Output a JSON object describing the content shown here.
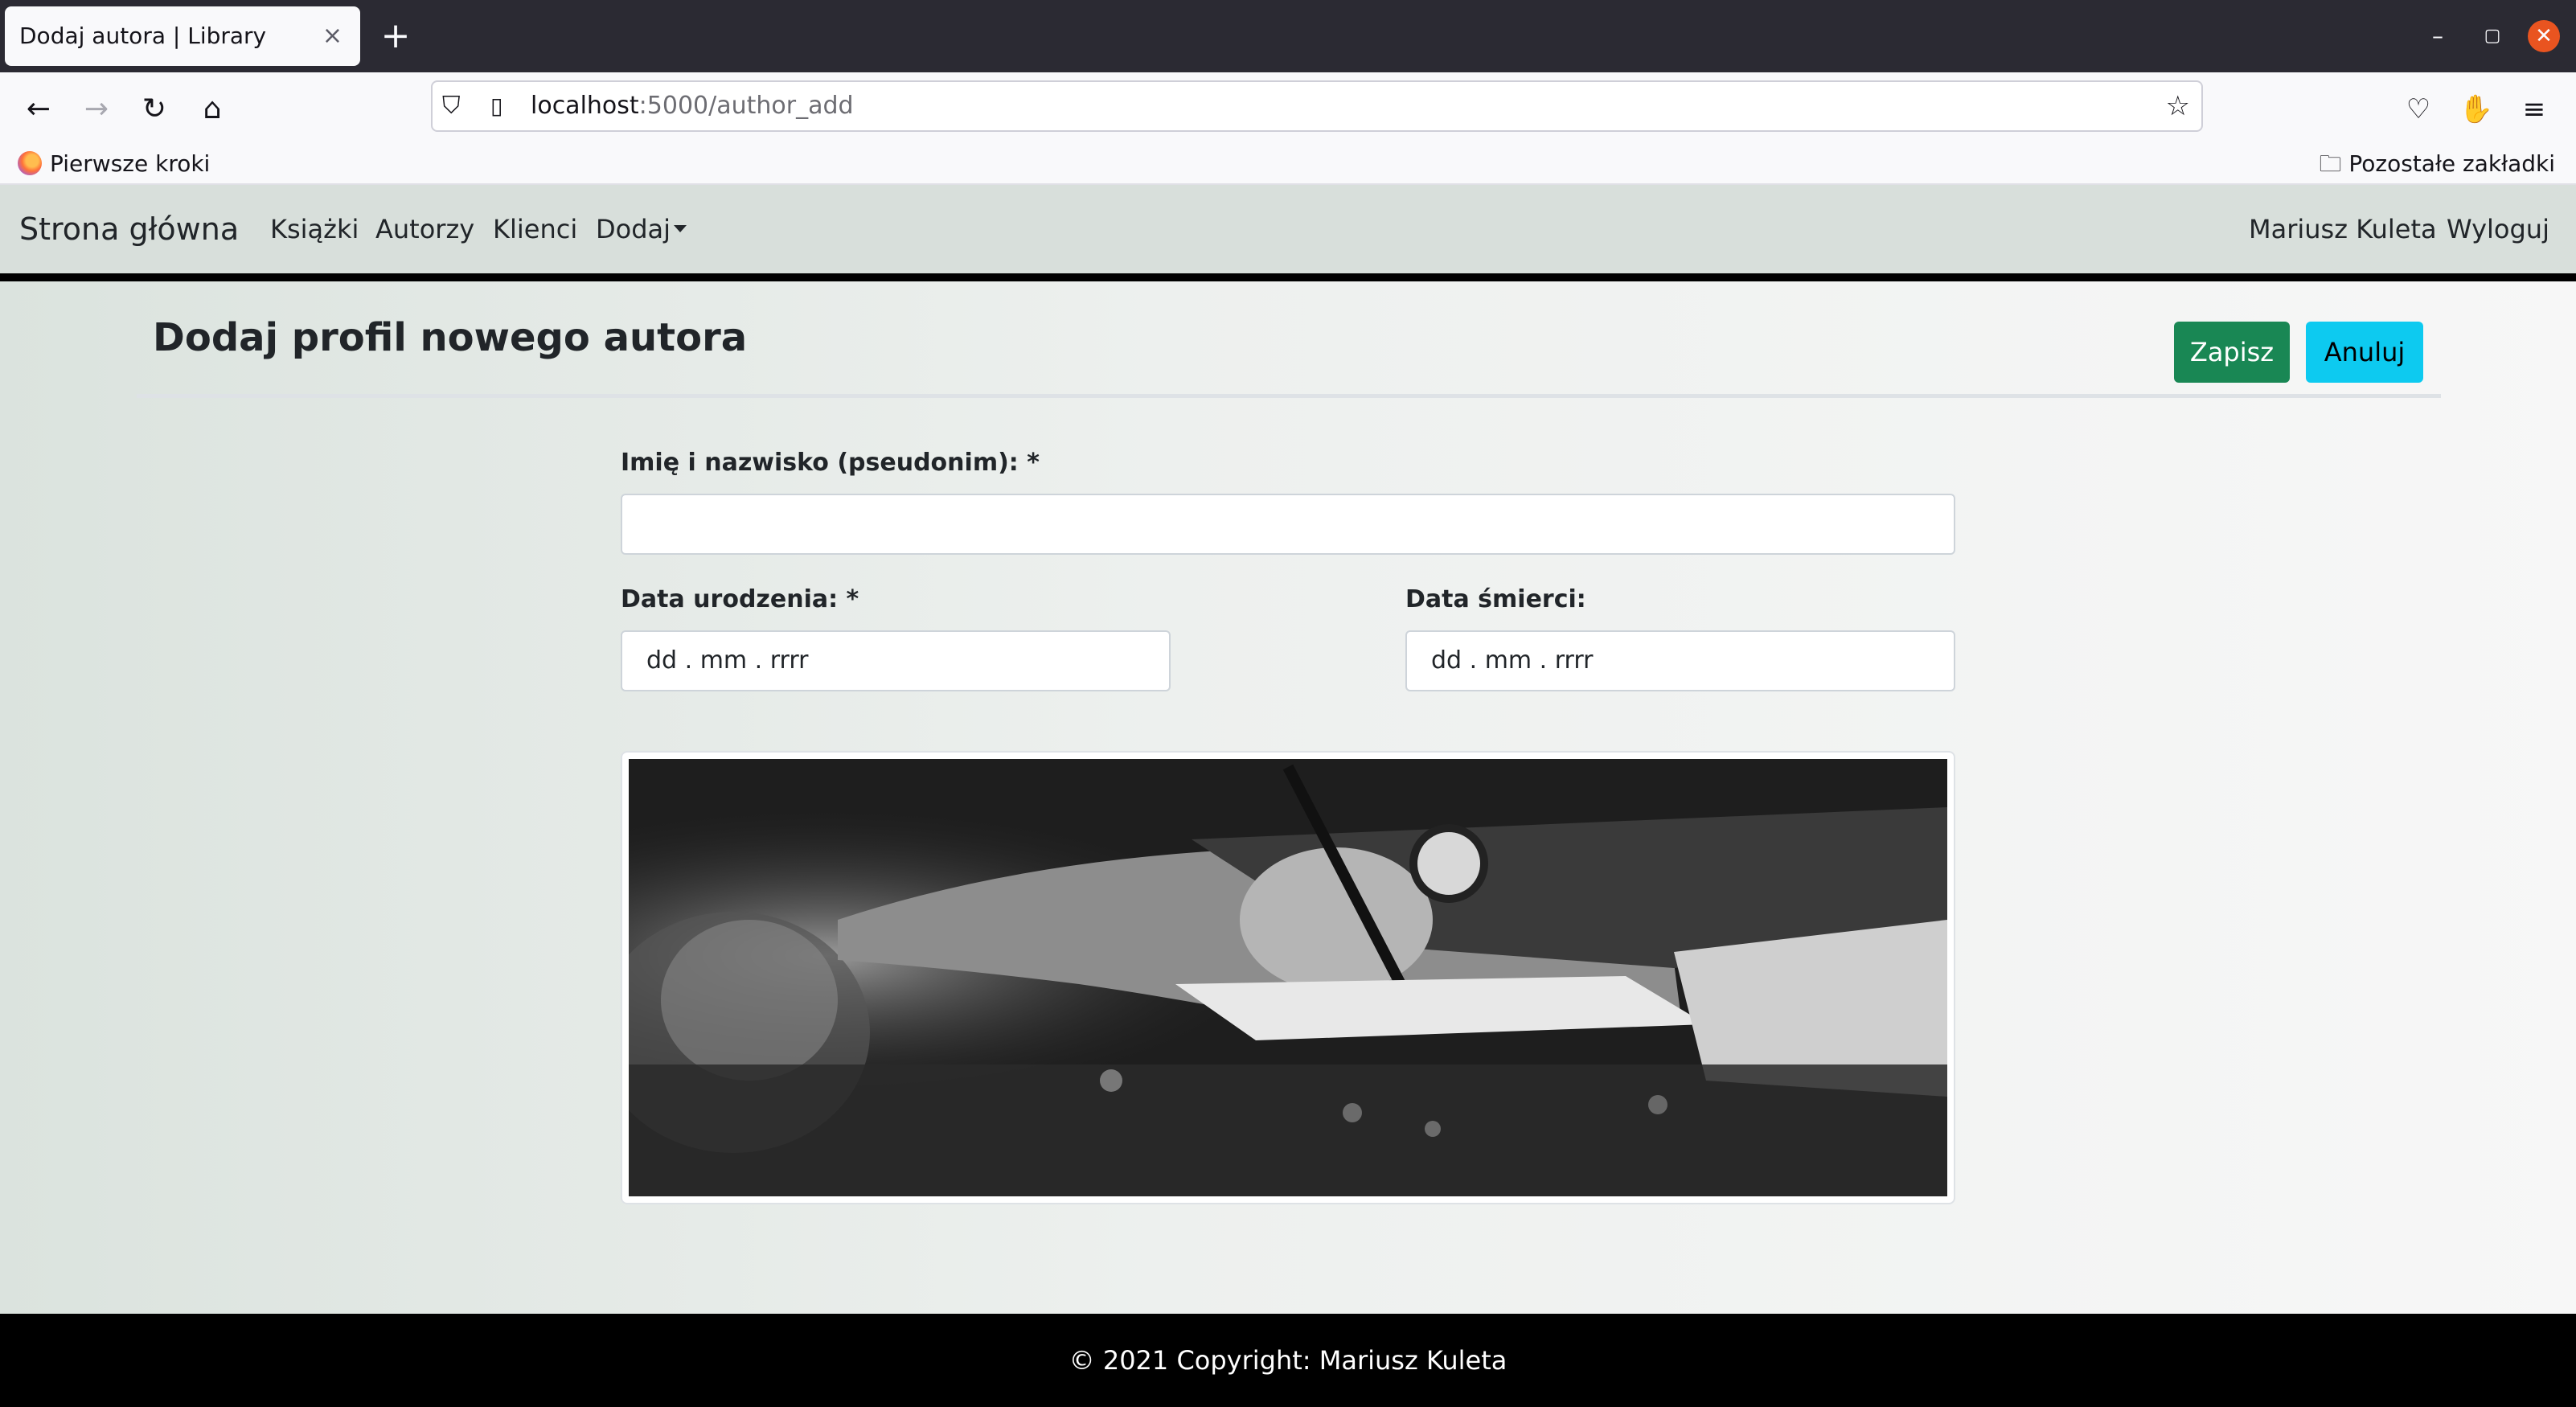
{
  "browser": {
    "tab_title": "Dodaj autora | Library",
    "tab_close": "×",
    "new_tab": "+",
    "url_host": "localhost",
    "url_path": ":5000/author_add",
    "bookmark_left": "Pierwsze kroki",
    "bookmark_right": "Pozostałe zakładki",
    "window_controls": {
      "minimize": "–",
      "maximize": "▢",
      "close": "✕"
    }
  },
  "site_nav": {
    "brand": "Strona główna",
    "links": [
      "Książki",
      "Autorzy",
      "Klienci",
      "Dodaj"
    ],
    "user": "Mariusz Kuleta",
    "logout": "Wyloguj"
  },
  "page": {
    "title": "Dodaj profil nowego autora",
    "save_label": "Zapisz",
    "cancel_label": "Anuluj"
  },
  "form": {
    "name_label": "Imię i nazwisko (pseudonim): *",
    "name_value": "",
    "birth_label": "Data urodzenia: *",
    "birth_value": "dd . mm . rrrr",
    "death_label": "Data śmierci:",
    "death_value": "dd . mm . rrrr"
  },
  "footer": {
    "text": "© 2021 Copyright: Mariusz Kuleta"
  },
  "colors": {
    "save": "#198754",
    "cancel": "#0dcaf0",
    "navbar": "#d8dfdb",
    "footer": "#000000"
  }
}
